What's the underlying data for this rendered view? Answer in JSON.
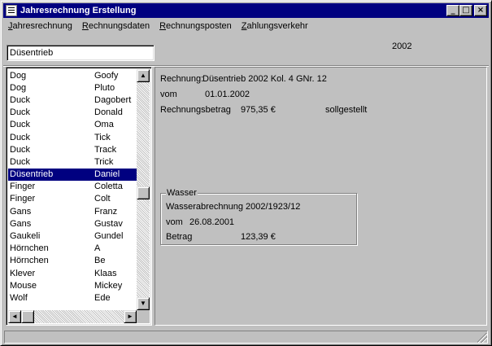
{
  "window": {
    "title": "Jahresrechnung Erstellung",
    "controls": {
      "minimize": "_",
      "maximize": "□",
      "close": "×"
    }
  },
  "menu": [
    {
      "label": "Jahresrechnung",
      "accel_index": 0
    },
    {
      "label": "Rechnungsdaten",
      "accel_index": 0
    },
    {
      "label": "Rechnungsposten",
      "accel_index": 0
    },
    {
      "label": "Zahlungsverkehr",
      "accel_index": 0
    }
  ],
  "search": {
    "value": "Düsentrieb"
  },
  "year": "2002",
  "list": {
    "rows": [
      {
        "last": "Dog",
        "first": "Goofy"
      },
      {
        "last": "Dog",
        "first": "Pluto"
      },
      {
        "last": "Duck",
        "first": "Dagobert"
      },
      {
        "last": "Duck",
        "first": "Donald"
      },
      {
        "last": "Duck",
        "first": "Oma"
      },
      {
        "last": "Duck",
        "first": "Tick"
      },
      {
        "last": "Duck",
        "first": "Track"
      },
      {
        "last": "Duck",
        "first": "Trick"
      },
      {
        "last": "Düsentrieb",
        "first": "Daniel",
        "selected": true
      },
      {
        "last": "Finger",
        "first": "Coletta"
      },
      {
        "last": "Finger",
        "first": "Colt"
      },
      {
        "last": "Gans",
        "first": "Franz"
      },
      {
        "last": "Gans",
        "first": "Gustav"
      },
      {
        "last": "Gaukeli",
        "first": "Gundel"
      },
      {
        "last": "Hörnchen",
        "first": "A"
      },
      {
        "last": "Hörnchen",
        "first": "Be"
      },
      {
        "last": "Klever",
        "first": "Klaas"
      },
      {
        "last": "Mouse",
        "first": "Mickey"
      },
      {
        "last": "Wolf",
        "first": "Ede"
      }
    ],
    "scroll_up_icon": "arrow-up-icon",
    "scroll_down_icon": "arrow-down-icon"
  },
  "invoice": {
    "label": "Rechnung:",
    "text": "Düsentrieb 2002 Kol. 4 GNr. 12",
    "vom_label": "vom",
    "vom_date": "01.01.2002",
    "betrag_label": "Rechnungsbetrag",
    "betrag_value": "975,35 €",
    "status": "sollgestellt"
  },
  "water": {
    "group_title": "Wasser",
    "text": "Wasserabrechnung 2002/1923/12",
    "vom_label": "vom",
    "vom_date": "26.08.2001",
    "betrag_label": "Betrag",
    "betrag_value": "123,39 €"
  }
}
